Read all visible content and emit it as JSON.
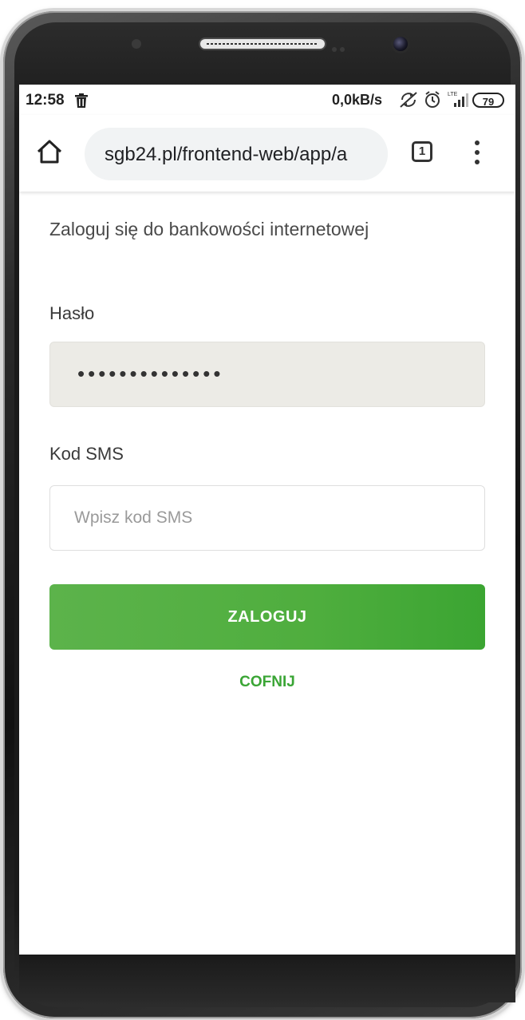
{
  "statusbar": {
    "time": "12:58",
    "speed": "0,0kB/s",
    "network": "LTE",
    "battery": "79"
  },
  "browser": {
    "url": "sgb24.pl/frontend-web/app/a",
    "tab_count": "1"
  },
  "login": {
    "intro": "Zaloguj się do bankowości internetowej",
    "password_label": "Hasło",
    "password_mask": "••••••••••••••",
    "sms_label": "Kod SMS",
    "sms_placeholder": "Wpisz kod SMS",
    "submit_label": "ZALOGUJ",
    "back_label": "COFNIJ"
  },
  "colors": {
    "accent": "#4fae3e",
    "link": "#3aa535",
    "password_field_bg": "#ecebe6"
  }
}
